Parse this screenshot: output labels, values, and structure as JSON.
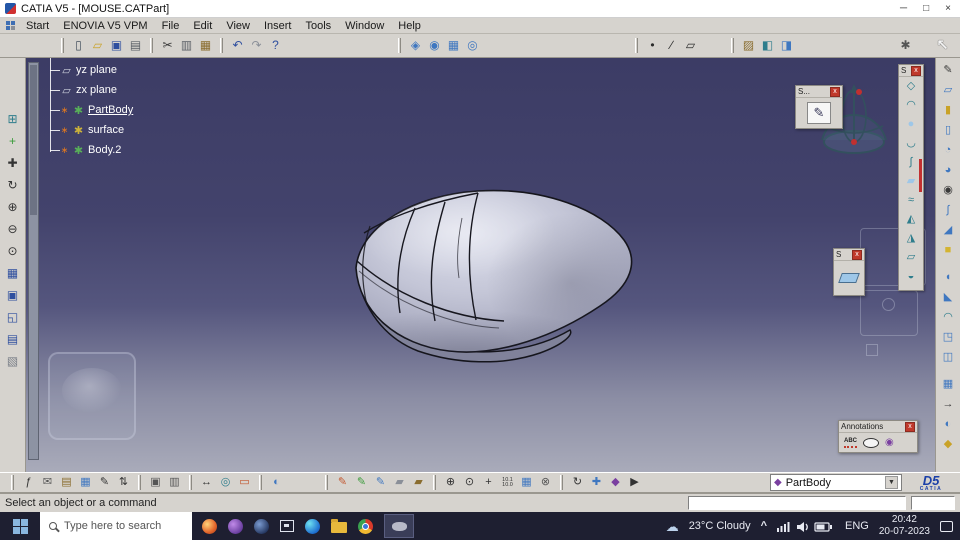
{
  "titlebar": {
    "title": "CATIA V5 - [MOUSE.CATPart]",
    "controls": {
      "minimize": "─",
      "maximize": "□",
      "close": "×"
    }
  },
  "menubar": {
    "items": [
      {
        "label": "Start",
        "name": "menu-start"
      },
      {
        "label": "ENOVIA V5 VPM",
        "name": "menu-enovia-v5-vpm"
      },
      {
        "label": "File",
        "name": "menu-file"
      },
      {
        "label": "Edit",
        "name": "menu-edit"
      },
      {
        "label": "View",
        "name": "menu-view"
      },
      {
        "label": "Insert",
        "name": "menu-insert"
      },
      {
        "label": "Tools",
        "name": "menu-tools"
      },
      {
        "label": "Window",
        "name": "menu-window"
      },
      {
        "label": "Help",
        "name": "menu-help"
      }
    ]
  },
  "top_toolbar": {
    "file_group": [
      {
        "name": "new-document-icon",
        "glyph": "▯",
        "color": "#44505e"
      },
      {
        "name": "open-folder-icon",
        "glyph": "▱",
        "color": "#c9a227"
      },
      {
        "name": "save-icon",
        "glyph": "▣",
        "color": "#2f4f9f"
      },
      {
        "name": "print-icon",
        "glyph": "▤",
        "color": "#5a5f66"
      }
    ],
    "edit_group": [
      {
        "name": "cut-icon",
        "glyph": "✂",
        "color": "#3a3a3a"
      },
      {
        "name": "copy-icon",
        "glyph": "▥",
        "color": "#5a5f66"
      },
      {
        "name": "paste-icon",
        "glyph": "▦",
        "color": "#8a6d2f"
      }
    ],
    "undo_group": [
      {
        "name": "undo-icon",
        "glyph": "↶",
        "color": "#2f4f9f"
      },
      {
        "name": "redo-icon",
        "glyph": "↷",
        "color": "#8a8f98"
      },
      {
        "name": "whats-this-help-icon",
        "glyph": "?",
        "color": "#2f4f9f"
      }
    ],
    "view_group": [
      {
        "name": "fly-mode-icon",
        "glyph": "◈",
        "color": "#3f77c0"
      },
      {
        "name": "look-at-icon",
        "glyph": "◉",
        "color": "#3f77c0"
      },
      {
        "name": "grid-icon",
        "glyph": "▦",
        "color": "#3f77c0"
      },
      {
        "name": "zoom-area-icon",
        "glyph": "◎",
        "color": "#3f77c0"
      }
    ],
    "geometry_group": [
      {
        "name": "point-icon",
        "glyph": "•",
        "color": "#2b2b2b"
      },
      {
        "name": "line-icon",
        "glyph": "∕",
        "color": "#2b2b2b"
      },
      {
        "name": "plane-icon",
        "glyph": "▱",
        "color": "#2b2b2b"
      }
    ],
    "tools_group": [
      {
        "name": "catalog-icon",
        "glyph": "▨",
        "color": "#8a6d2f"
      },
      {
        "name": "render-icon",
        "glyph": "◧",
        "color": "#2e7d8c"
      },
      {
        "name": "measure-tool-icon",
        "glyph": "◨",
        "color": "#3f77c0"
      }
    ],
    "settings_gear_glyph": {
      "name": "settings-gear-icon",
      "glyph": "✱",
      "color": "#555555"
    },
    "select_arrow": {
      "name": "select-arrow-icon",
      "glyph": "↖",
      "color": "#f5f5f5",
      "size": "15px"
    }
  },
  "left_toolbar": {
    "icons": [
      {
        "name": "fit-all-icon",
        "glyph": "⊞",
        "color": "#2e7d8c"
      },
      {
        "name": "sketcher-access-icon",
        "glyph": "+",
        "color": "#3a9b3a"
      },
      {
        "name": "pan-icon",
        "glyph": "✚",
        "color": "#333333"
      },
      {
        "name": "rotate-view-icon",
        "glyph": "↻",
        "color": "#333333"
      },
      {
        "name": "zoom-in-icon",
        "glyph": "⊕",
        "color": "#333333"
      },
      {
        "name": "zoom-out-icon",
        "glyph": "⊖",
        "color": "#333333"
      },
      {
        "name": "normal-view-icon",
        "glyph": "⊙",
        "color": "#333333"
      },
      {
        "name": "multi-view-icon",
        "glyph": "▦",
        "color": "#2f4f9f"
      },
      {
        "name": "window-icon",
        "glyph": "▣",
        "color": "#2f4f9f"
      },
      {
        "name": "screen-icon",
        "glyph": "◱",
        "color": "#2f4f9f"
      },
      {
        "name": "report-icon",
        "glyph": "▤",
        "color": "#2f4f9f"
      },
      {
        "name": "light-effect-icon",
        "glyph": "▧",
        "color": "#7a7f88"
      }
    ]
  },
  "right_toolbar_main": {
    "upper": [
      {
        "name": "sketcher-icon",
        "glyph": "✎",
        "color": "#3a3a3a"
      },
      {
        "name": "plane-feature-icon",
        "glyph": "▱",
        "color": "#3f77c0"
      },
      {
        "name": "pad-icon",
        "glyph": "▮",
        "color": "#c9a227"
      },
      {
        "name": "pocket-icon",
        "glyph": "▯",
        "color": "#3f77c0"
      },
      {
        "name": "shaft-icon",
        "glyph": "◔",
        "color": "#3f77c0"
      },
      {
        "name": "groove-icon",
        "glyph": "◕",
        "color": "#3f77c0"
      },
      {
        "name": "hole-icon",
        "glyph": "◉",
        "color": "#3a3a3a"
      },
      {
        "name": "rib-icon",
        "glyph": "∫",
        "color": "#3f77c0"
      },
      {
        "name": "stiffener-icon",
        "glyph": "◢",
        "color": "#3f77c0"
      },
      {
        "name": "cube-icon",
        "glyph": "■",
        "color": "#d4b431"
      }
    ],
    "middle": [
      {
        "name": "fillet-icon",
        "glyph": "◖",
        "color": "#3f77c0"
      },
      {
        "name": "chamfer-icon",
        "glyph": "◣",
        "color": "#3f77c0"
      },
      {
        "name": "draft-icon",
        "glyph": "◠",
        "color": "#2e7d8c"
      },
      {
        "name": "shell-icon",
        "glyph": "◳",
        "color": "#3f77c0"
      },
      {
        "name": "mirror-icon",
        "glyph": "◫",
        "color": "#3f77c0"
      }
    ],
    "lower": [
      {
        "name": "pattern-icon",
        "glyph": "▦",
        "color": "#3f77c0"
      },
      {
        "name": "translate-icon",
        "glyph": "→",
        "color": "#3a3a3a"
      },
      {
        "name": "boolean-icon",
        "glyph": "◐",
        "color": "#3f77c0"
      },
      {
        "name": "insert-body-icon",
        "glyph": "◆",
        "color": "#c9a227"
      }
    ]
  },
  "right_toolbar_surface": {
    "title": "S",
    "icons": [
      {
        "name": "extrude-surface-icon",
        "glyph": "◇",
        "color": "#2e7d8c"
      },
      {
        "name": "revolve-surface-icon",
        "glyph": "◠",
        "color": "#2e7d8c"
      },
      {
        "name": "sphere-surface-icon",
        "glyph": "●",
        "color": "#9ec7e8"
      },
      {
        "name": "offset-surface-icon",
        "glyph": "◡",
        "color": "#2e7d8c"
      },
      {
        "name": "sweep-surface-icon",
        "glyph": "∫",
        "color": "#2e7d8c"
      },
      {
        "name": "fill-surface-icon",
        "glyph": "▰",
        "color": "#9ec7e8"
      },
      {
        "name": "blend-surface-icon",
        "glyph": "≈",
        "color": "#2e7d8c"
      },
      {
        "name": "split-surface-icon",
        "glyph": "◭",
        "color": "#2e7d8c"
      },
      {
        "name": "trim-surface-icon",
        "glyph": "◮",
        "color": "#2e7d8c"
      },
      {
        "name": "boundary-surface-icon",
        "glyph": "▱",
        "color": "#2e7d8c"
      },
      {
        "name": "join-surface-icon",
        "glyph": "◒",
        "color": "#2e7d8c"
      }
    ]
  },
  "float_panel_sketch": {
    "title": "S...",
    "close": "x"
  },
  "float_panel_small": {
    "title": "S",
    "close": "x"
  },
  "annotations_panel": {
    "title": "Annotations",
    "close": "x",
    "abc_label": "ABC"
  },
  "tree": {
    "items": [
      {
        "name": "tree-item-yz-plane",
        "label": "yz plane",
        "icon_glyph": "▱",
        "icon_color": "#c9cdda",
        "marker": "",
        "label_class": "tree-label"
      },
      {
        "name": "tree-item-zx-plane",
        "label": "zx plane",
        "icon_glyph": "▱",
        "icon_color": "#c9cdda",
        "marker": "",
        "label_class": "tree-label"
      },
      {
        "name": "tree-item-partbody",
        "label": "PartBody",
        "icon_glyph": "✱",
        "icon_color": "#58b058",
        "marker": "∗",
        "label_class": "tree-label tree-label-underlined"
      },
      {
        "name": "tree-item-surface",
        "label": "surface",
        "icon_glyph": "✱",
        "icon_color": "#cbb23a",
        "marker": "∗",
        "label_class": "tree-label"
      },
      {
        "name": "tree-item-body-2",
        "label": "Body.2",
        "icon_glyph": "✱",
        "icon_color": "#58b058",
        "marker": "∗",
        "label_class": "tree-label"
      }
    ]
  },
  "bottom_toolbar": {
    "group_a": [
      {
        "name": "fx-knowledge-icon",
        "glyph": "ƒ",
        "color": "#333333"
      },
      {
        "name": "comment-icon",
        "glyph": "✉",
        "color": "#555555"
      },
      {
        "name": "catalog-browser-icon",
        "glyph": "▤",
        "color": "#8a6d2f"
      },
      {
        "name": "grid-snap-icon",
        "glyph": "▦",
        "color": "#3f77c0"
      },
      {
        "name": "sketch-analysis-icon",
        "glyph": "✎",
        "color": "#333333"
      },
      {
        "name": "exchange-icon",
        "glyph": "⇅",
        "color": "#333333"
      }
    ],
    "group_b": [
      {
        "name": "copy-view-icon",
        "glyph": "▣",
        "color": "#555555"
      },
      {
        "name": "album-icon",
        "glyph": "▥",
        "color": "#555555"
      }
    ],
    "group_c": [
      {
        "name": "measure-between-icon",
        "glyph": "↔",
        "color": "#333333"
      },
      {
        "name": "measure-inertia-icon",
        "glyph": "◎",
        "color": "#2e7d8c"
      },
      {
        "name": "apply-material-icon",
        "glyph": "▭",
        "color": "#c2572f"
      }
    ],
    "group_d": [
      {
        "name": "shading-mode-icon",
        "glyph": "◐",
        "color": "#3f77c0"
      }
    ],
    "group_e": [
      {
        "name": "pen-red-icon",
        "glyph": "✎",
        "color": "#c2572f"
      },
      {
        "name": "pen-green-icon",
        "glyph": "✎",
        "color": "#3a9b3a"
      },
      {
        "name": "pen-blue-icon",
        "glyph": "✎",
        "color": "#3f77c0"
      },
      {
        "name": "eraser-icon",
        "glyph": "▰",
        "color": "#8a8f98"
      },
      {
        "name": "brush-icon",
        "glyph": "▰",
        "color": "#8a6d2f"
      }
    ],
    "group_f": [
      {
        "name": "hide-show-icon",
        "glyph": "⊕",
        "color": "#333333"
      },
      {
        "name": "light-toggle-icon",
        "glyph": "⊙",
        "color": "#333333"
      },
      {
        "name": "axis-system-icon",
        "glyph": "+",
        "color": "#333333"
      },
      {
        "name": "dimension-values-icon",
        "glyph": "10.1\n10.0",
        "color": "#333333",
        "size": "5.5px"
      },
      {
        "name": "table-icon",
        "glyph": "▦",
        "color": "#3f77c0"
      },
      {
        "name": "tool-options-icon",
        "glyph": "⊗",
        "color": "#555555"
      }
    ],
    "group_g": [
      {
        "name": "update-icon",
        "glyph": "↻",
        "color": "#333333"
      },
      {
        "name": "manipulation-icon",
        "glyph": "✚",
        "color": "#3f77c0"
      },
      {
        "name": "datum-icon",
        "glyph": "◆",
        "color": "#7a3fa0"
      },
      {
        "name": "scan-icon",
        "glyph": "▶",
        "color": "#333333"
      }
    ],
    "combo": {
      "icon_glyph": "◆",
      "label": "PartBody",
      "arrow": "▼"
    },
    "logo_line1": "D5",
    "logo_line2": "CATIA"
  },
  "statusbar": {
    "message": "Select an object or a command"
  },
  "taskbar": {
    "search_placeholder": "Type here to search",
    "weather_icon_glyph": "☁",
    "weather_text": "23°C Cloudy",
    "chevron": "^",
    "language": "ENG",
    "time": "20:42",
    "date": "20-07-2023"
  }
}
